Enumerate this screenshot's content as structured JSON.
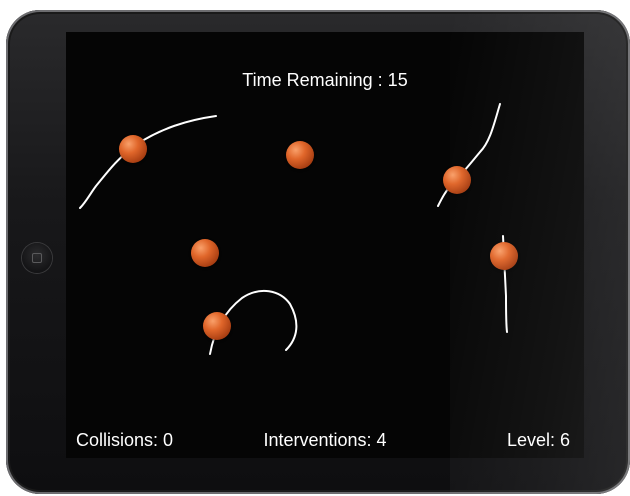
{
  "hud": {
    "timer": "Time Remaining : 15",
    "collisions": "Collisions: 0",
    "interventions": "Interventions: 4",
    "level": "Level: 6"
  },
  "colors": {
    "background": "#050505",
    "ball": "#d9622a",
    "path": "#ffffff",
    "text": "#ffffff"
  },
  "icons": {
    "home": "home-button-icon"
  }
}
